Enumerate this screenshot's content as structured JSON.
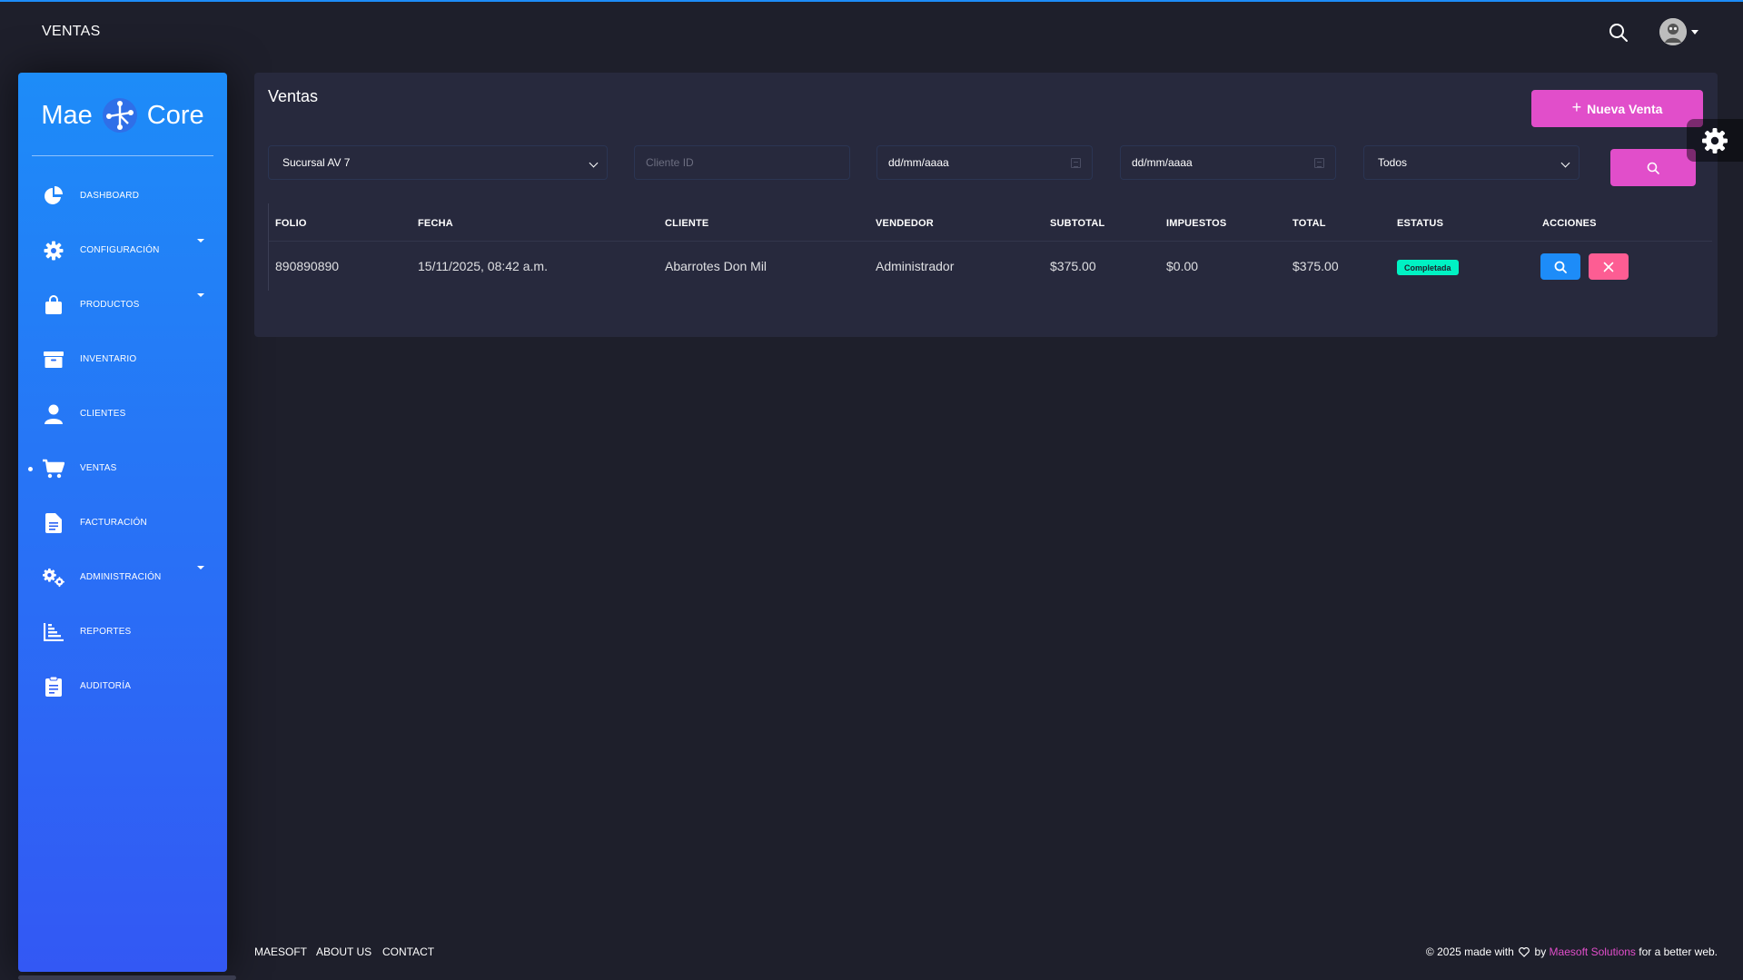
{
  "navbar": {
    "title": "VENTAS",
    "search_icon": "search-icon",
    "avatar_icon": "user-avatar"
  },
  "sidebar": {
    "logo": {
      "left": "Mae",
      "right": "Core"
    },
    "items": [
      {
        "label": "DASHBOARD",
        "icon": "pie-chart-icon"
      },
      {
        "label": "CONFIGURACIÓN",
        "icon": "gear-icon",
        "has_submenu": true
      },
      {
        "label": "PRODUCTOS",
        "icon": "shopping-bag-icon",
        "has_submenu": true
      },
      {
        "label": "INVENTARIO",
        "icon": "archive-box-icon"
      },
      {
        "label": "CLIENTES",
        "icon": "user-icon"
      },
      {
        "label": "VENTAS",
        "icon": "cart-icon",
        "active": true
      },
      {
        "label": "FACTURACIÓN",
        "icon": "invoice-icon"
      },
      {
        "label": "ADMINISTRACIÓN",
        "icon": "gears-icon",
        "has_submenu": true
      },
      {
        "label": "REPORTES",
        "icon": "bar-chart-icon"
      },
      {
        "label": "AUDITORÍA",
        "icon": "clipboard-icon"
      }
    ]
  },
  "main": {
    "title": "Ventas",
    "new_button": {
      "plus": "+",
      "label": "Nueva Venta"
    },
    "filters": {
      "branch": "Sucursal AV 7",
      "client_placeholder": "Cliente ID",
      "date_from": "dd/mm/aaaa",
      "date_to": "dd/mm/aaaa",
      "status": "Todos"
    },
    "table": {
      "headers": [
        "FOLIO",
        "FECHA",
        "CLIENTE",
        "VENDEDOR",
        "SUBTOTAL",
        "IMPUESTOS",
        "TOTAL",
        "ESTATUS",
        "ACCIONES"
      ],
      "rows": [
        {
          "folio": "890890890",
          "fecha": "15/11/2025, 08:42 a.m.",
          "cliente": "Abarrotes Don Mil",
          "vendedor": "Administrador",
          "subtotal": "$375.00",
          "impuestos": "$0.00",
          "total": "$375.00",
          "estatus": "Completada"
        }
      ]
    }
  },
  "footer": {
    "links": [
      "MAESOFT",
      "ABOUT US",
      "CONTACT"
    ],
    "copyright_prefix": "© 2025 made with",
    "copyright_by": "by",
    "brand": "Maesoft Solutions",
    "copyright_suffix": "for a better web."
  },
  "colors": {
    "background": "#1e1f2b",
    "card": "#27293d",
    "sidebar_gradient_top": "#1d8cf8",
    "sidebar_gradient_bottom": "#3358f4",
    "primary": "#e14eca",
    "info": "#1d8cf8",
    "danger": "#fd5d93",
    "success": "#00f2c3"
  }
}
